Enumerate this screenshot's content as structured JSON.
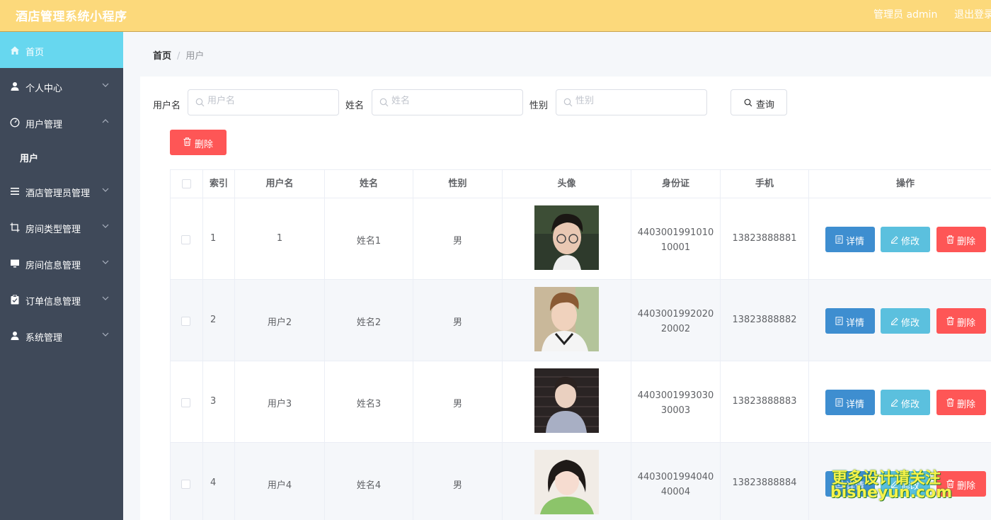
{
  "app": {
    "title": "酒店管理系统小程序"
  },
  "header": {
    "admin_label": "管理员 admin",
    "logout_label": "退出登录"
  },
  "sidebar": {
    "items": [
      {
        "label": "首页",
        "icon": "home-icon",
        "active": true
      },
      {
        "label": "个人中心",
        "icon": "person-icon"
      },
      {
        "label": "用户管理",
        "icon": "dashboard-icon",
        "expanded": true
      },
      {
        "label": "酒店管理员管理",
        "icon": "list-icon"
      },
      {
        "label": "房间类型管理",
        "icon": "crop-icon"
      },
      {
        "label": "房间信息管理",
        "icon": "monitor-icon"
      },
      {
        "label": "订单信息管理",
        "icon": "clipboard-icon"
      },
      {
        "label": "系统管理",
        "icon": "person-icon"
      }
    ],
    "sub_items": [
      {
        "label": "用户"
      }
    ]
  },
  "breadcrumb": {
    "home": "首页",
    "current": "用户"
  },
  "search": {
    "username_label": "用户名",
    "username_placeholder": "用户名",
    "name_label": "姓名",
    "name_placeholder": "姓名",
    "gender_label": "性别",
    "gender_placeholder": "性别",
    "query_label": "查询"
  },
  "toolbar": {
    "delete_label": "删除"
  },
  "table": {
    "columns": [
      "索引",
      "用户名",
      "姓名",
      "性别",
      "头像",
      "身份证",
      "手机",
      "操作"
    ],
    "rows": [
      {
        "index": "1",
        "username": "1",
        "name": "姓名1",
        "gender": "男",
        "id_card": "440300199101010001",
        "phone": "13823888881"
      },
      {
        "index": "2",
        "username": "用户2",
        "name": "姓名2",
        "gender": "男",
        "id_card": "440300199202020002",
        "phone": "13823888882"
      },
      {
        "index": "3",
        "username": "用户3",
        "name": "姓名3",
        "gender": "男",
        "id_card": "440300199303030003",
        "phone": "13823888883"
      },
      {
        "index": "4",
        "username": "用户4",
        "name": "姓名4",
        "gender": "男",
        "id_card": "440300199404040004",
        "phone": "13823888884"
      }
    ],
    "actions": {
      "detail": "详情",
      "edit": "修改",
      "delete": "删除"
    }
  },
  "watermark": {
    "line1": "更多设计请关注",
    "line2": "bisheyun.com"
  },
  "colors": {
    "header": "#fcd97b",
    "sidebar": "#3f4959",
    "active_menu": "#67d7ef",
    "danger": "#fe5656",
    "primary": "#3e8ed0",
    "info": "#5bc0de"
  }
}
